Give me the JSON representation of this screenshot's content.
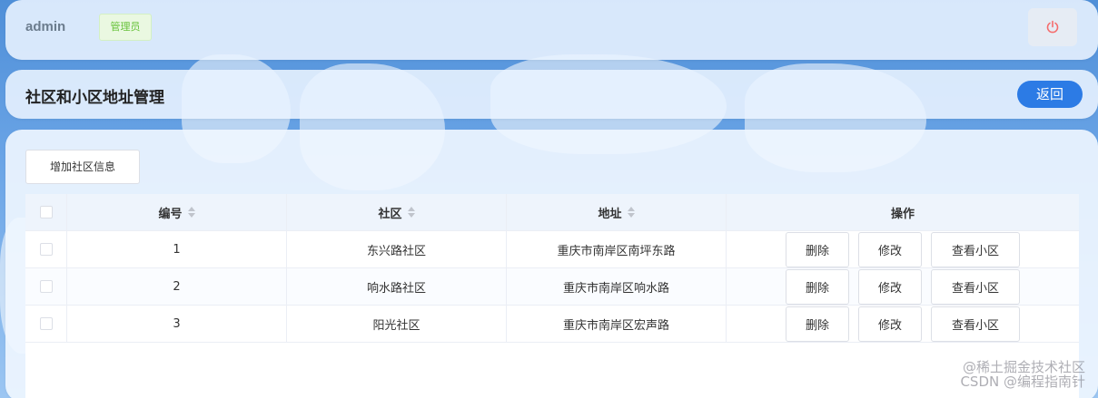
{
  "header": {
    "username": "admin",
    "role": "管理员",
    "power_icon": "power-icon"
  },
  "titlebar": {
    "title": "社区和小区地址管理",
    "back_label": "返回"
  },
  "toolbar": {
    "add_label": "增加社区信息"
  },
  "table": {
    "columns": [
      "编号",
      "社区",
      "地址",
      "操作"
    ],
    "rows": [
      {
        "id": "1",
        "community": "东兴路社区",
        "address": "重庆市南岸区南坪东路"
      },
      {
        "id": "2",
        "community": "响水路社区",
        "address": "重庆市南岸区响水路"
      },
      {
        "id": "3",
        "community": "阳光社区",
        "address": "重庆市南岸区宏声路"
      }
    ],
    "actions": {
      "delete": "删除",
      "edit": "修改",
      "view": "查看小区"
    }
  },
  "watermark": {
    "line1": "@稀土掘金技术社区",
    "line2": "CSDN @编程指南针"
  },
  "colors": {
    "accent": "#2c7be5",
    "danger": "#f56c6c",
    "success": "#67c23a"
  }
}
